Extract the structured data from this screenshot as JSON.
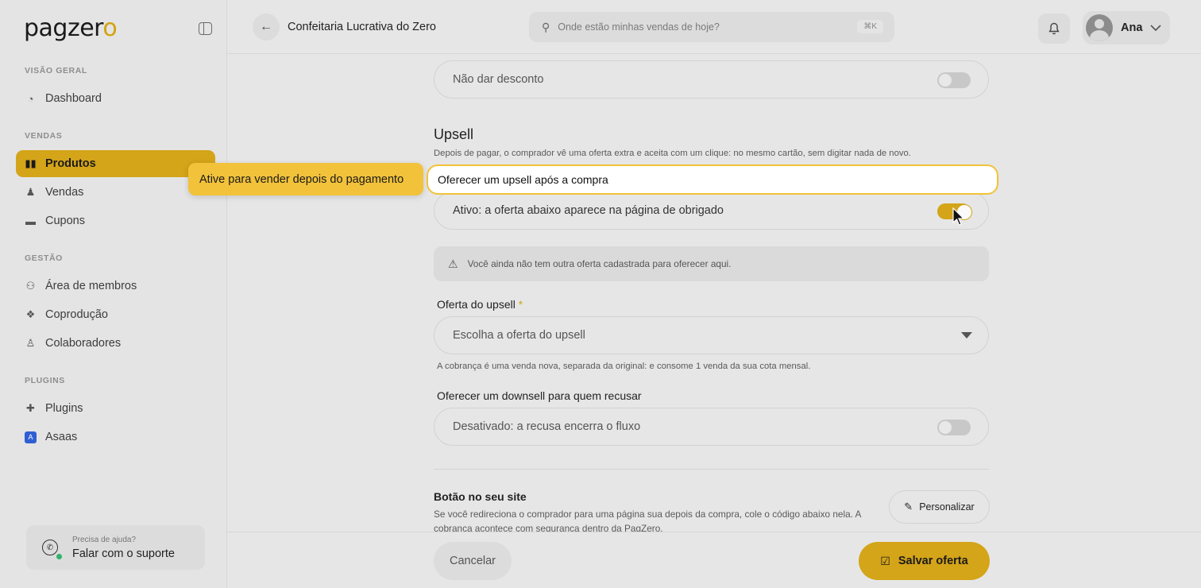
{
  "brand": {
    "logo_prefix": "pagzer",
    "logo_suffix": "o",
    "accent": "#d4a419"
  },
  "sidebar": {
    "sections": [
      {
        "label": "VISÃO GERAL"
      },
      {
        "label": "VENDAS"
      },
      {
        "label": "GESTÃO"
      },
      {
        "label": "PLUGINS"
      }
    ],
    "items": [
      {
        "label": "Dashboard",
        "icon": "chart-pie-icon"
      },
      {
        "label": "Produtos",
        "icon": "products-icon",
        "active": true
      },
      {
        "label": "Vendas",
        "icon": "sales-icon"
      },
      {
        "label": "Cupons",
        "icon": "coupon-icon"
      },
      {
        "label": "Área de membros",
        "icon": "users-icon"
      },
      {
        "label": "Coprodução",
        "icon": "handshake-icon"
      },
      {
        "label": "Colaboradores",
        "icon": "user-icon"
      },
      {
        "label": "Plugins",
        "icon": "puzzle-icon"
      },
      {
        "label": "Asaas",
        "icon": "asaas-icon"
      }
    ],
    "help": {
      "small": "Precisa de ajuda?",
      "big": "Falar com o suporte"
    }
  },
  "topbar": {
    "title": "Confeitaria Lucrativa do Zero",
    "search_placeholder": "Onde estão minhas vendas de hoje?",
    "shortcut": "⌘K",
    "user_name": "Ana"
  },
  "main": {
    "discount_field": "Não dar desconto",
    "upsell_title": "Upsell",
    "upsell_desc": "Depois de pagar, o comprador vê uma oferta extra e aceita com um clique: no mesmo cartão, sem digitar nada de novo.",
    "upsell_toggle_label": "Oferecer um upsell após a compra",
    "upsell_active_text": "Ativo: a oferta abaixo aparece na página de obrigado",
    "warning": "Você ainda não tem outra oferta cadastrada para oferecer aqui.",
    "offer_label": "Oferta do upsell",
    "offer_required": "*",
    "offer_placeholder": "Escolha a oferta do upsell",
    "offer_hint": "A cobrança é uma venda nova, separada da original: e consome 1 venda da sua cota mensal.",
    "downsell_label": "Oferecer um downsell para quem recusar",
    "downsell_value": "Desativado: a recusa encerra o fluxo",
    "site_title": "Botão no seu site",
    "site_desc": "Se você redireciona o comprador para uma página sua depois da compra, cole o código abaixo nela. A cobrança acontece com segurança dentro da PagZero.",
    "personalize": "Personalizar"
  },
  "footer": {
    "cancel": "Cancelar",
    "save": "Salvar oferta"
  },
  "coachmark": {
    "tip": "Ative para vender depois do pagamento"
  }
}
